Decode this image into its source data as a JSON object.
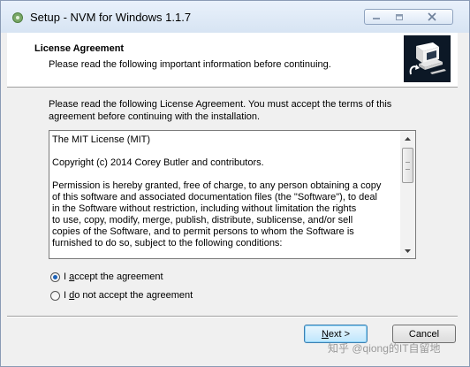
{
  "window": {
    "title": "Setup - NVM for Windows 1.1.7"
  },
  "header": {
    "title": "License Agreement",
    "subtitle": "Please read the following important information before continuing."
  },
  "intro": "Please read the following License Agreement. You must accept the terms of this agreement before continuing with the installation.",
  "license": {
    "paragraphs": [
      "The MIT License (MIT)",
      "Copyright (c) 2014 Corey Butler and contributors.",
      "Permission is hereby granted, free of charge, to any person obtaining a copy\nof this software and associated documentation files (the \"Software\"), to deal\nin the Software without restriction, including without limitation the rights\nto use, copy, modify, merge, publish, distribute, sublicense, and/or sell\ncopies of the Software, and to permit persons to whom the Software is\nfurnished to do so, subject to the following conditions:"
    ]
  },
  "options": {
    "accept": {
      "pre": "I ",
      "key": "a",
      "post": "ccept the agreement",
      "selected": true
    },
    "decline": {
      "pre": "I ",
      "key": "d",
      "post": "o not accept the agreement",
      "selected": false
    }
  },
  "buttons": {
    "next": {
      "key": "N",
      "post": "ext >"
    },
    "cancel": "Cancel"
  },
  "watermark": "知乎 @qiong的IT自留地",
  "icons": {
    "app": "nvm-leaf-icon",
    "logo": "computer-setup-icon"
  },
  "colors": {
    "titlebar": "#d7e4f3",
    "accent": "#1c62b8",
    "logo_bg": "#0c1826"
  }
}
